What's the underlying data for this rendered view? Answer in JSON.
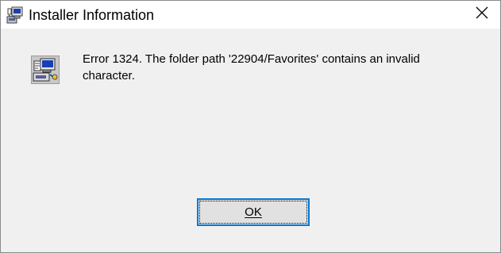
{
  "window": {
    "title": "Installer Information"
  },
  "dialog": {
    "message": "Error 1324. The folder path '22904/Favorites' contains an invalid character.",
    "ok_button_label": "OK"
  },
  "icons": {
    "title_icon": "installer-computer-icon",
    "message_icon": "installer-computer-icon",
    "close_icon": "close-icon"
  },
  "colors": {
    "button_focus_border": "#0078d7",
    "dialog_background": "#f0f0f0",
    "titlebar_background": "#ffffff"
  }
}
